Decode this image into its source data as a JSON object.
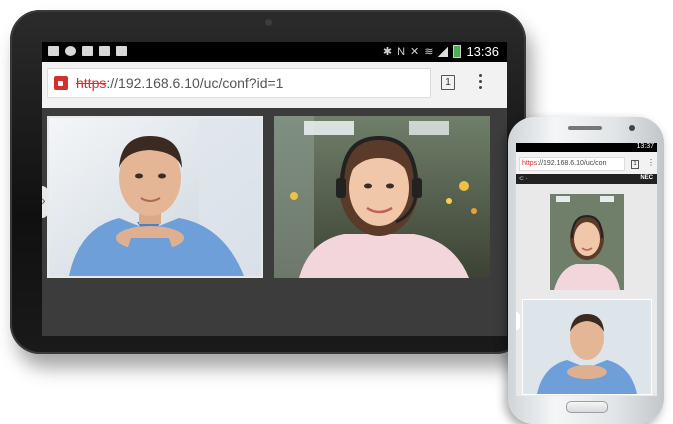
{
  "tablet": {
    "statusbar": {
      "time": "13:36"
    },
    "browser": {
      "url_scheme": "https",
      "url_rest": "://192.168.6.10/uc/conf?id=1",
      "tab_count": "1",
      "menu_label": "⋮"
    },
    "videos": [
      {
        "name": "male participant"
      },
      {
        "name": "female participant with headset"
      }
    ]
  },
  "phone": {
    "statusbar": {
      "time": "13:37"
    },
    "browser": {
      "url_scheme": "https",
      "url_rest": "://192.168.6.10/uc/con",
      "tab_count": "1",
      "menu_label": "⋮"
    },
    "appbar": {
      "left": "⊂ ·",
      "brand": "NEC"
    }
  },
  "colors": {
    "url_scheme": "#d32f2f",
    "bezel": "#101010",
    "conf_bg": "#3c3c3c"
  }
}
